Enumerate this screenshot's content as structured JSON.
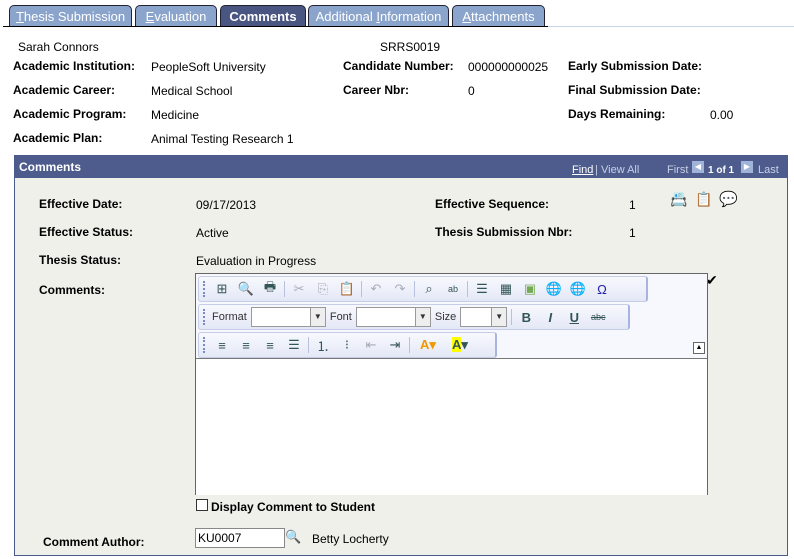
{
  "tabs": [
    {
      "label": "Thesis Submission",
      "u": "T",
      "rest": "hesis Submission"
    },
    {
      "label": "Evaluation",
      "u": "E",
      "rest": "valuation"
    },
    {
      "label": "Comments"
    },
    {
      "label": "Additional Information",
      "pre": "Additional ",
      "u": "I",
      "rest": "nformation"
    },
    {
      "label": "Attachments",
      "u": "A",
      "rest": "ttachments"
    }
  ],
  "header": {
    "name": "Sarah Connors",
    "id": "SRRS0019",
    "academic_institution_label": "Academic Institution:",
    "academic_institution": "PeopleSoft University",
    "academic_career_label": "Academic Career:",
    "academic_career": "Medical School",
    "academic_program_label": "Academic Program:",
    "academic_program": "Medicine",
    "academic_plan_label": "Academic Plan:",
    "academic_plan": "Animal Testing Research 1",
    "candidate_number_label": "Candidate Number:",
    "candidate_number": "000000000025",
    "career_nbr_label": "Career Nbr:",
    "career_nbr": "0",
    "early_submission_label": "Early Submission Date:",
    "final_submission_label": "Final Submission Date:",
    "days_remaining_label": "Days Remaining:",
    "days_remaining": "0.00"
  },
  "panel": {
    "title": "Comments",
    "find": "Find",
    "view_all": "View All",
    "first": "First",
    "count": "1 of 1",
    "last": "Last",
    "effective_date_label": "Effective Date:",
    "effective_date": "09/17/2013",
    "effective_status_label": "Effective Status:",
    "effective_status": "Active",
    "thesis_status_label": "Thesis Status:",
    "thesis_status": "Evaluation in Progress",
    "effective_sequence_label": "Effective Sequence:",
    "effective_sequence": "1",
    "thesis_submission_nbr_label": "Thesis Submission Nbr:",
    "thesis_submission_nbr": "1",
    "comments_label": "Comments:",
    "editor": {
      "format_label": "Format",
      "font_label": "Font",
      "size_label": "Size",
      "format": "",
      "font": "",
      "size": "",
      "content": ""
    },
    "display_comment_label": "Display Comment to Student",
    "display_comment_checked": false,
    "comment_author_label": "Comment Author:",
    "comment_author": "KU0007",
    "comment_author_name": "Betty Locherty"
  }
}
